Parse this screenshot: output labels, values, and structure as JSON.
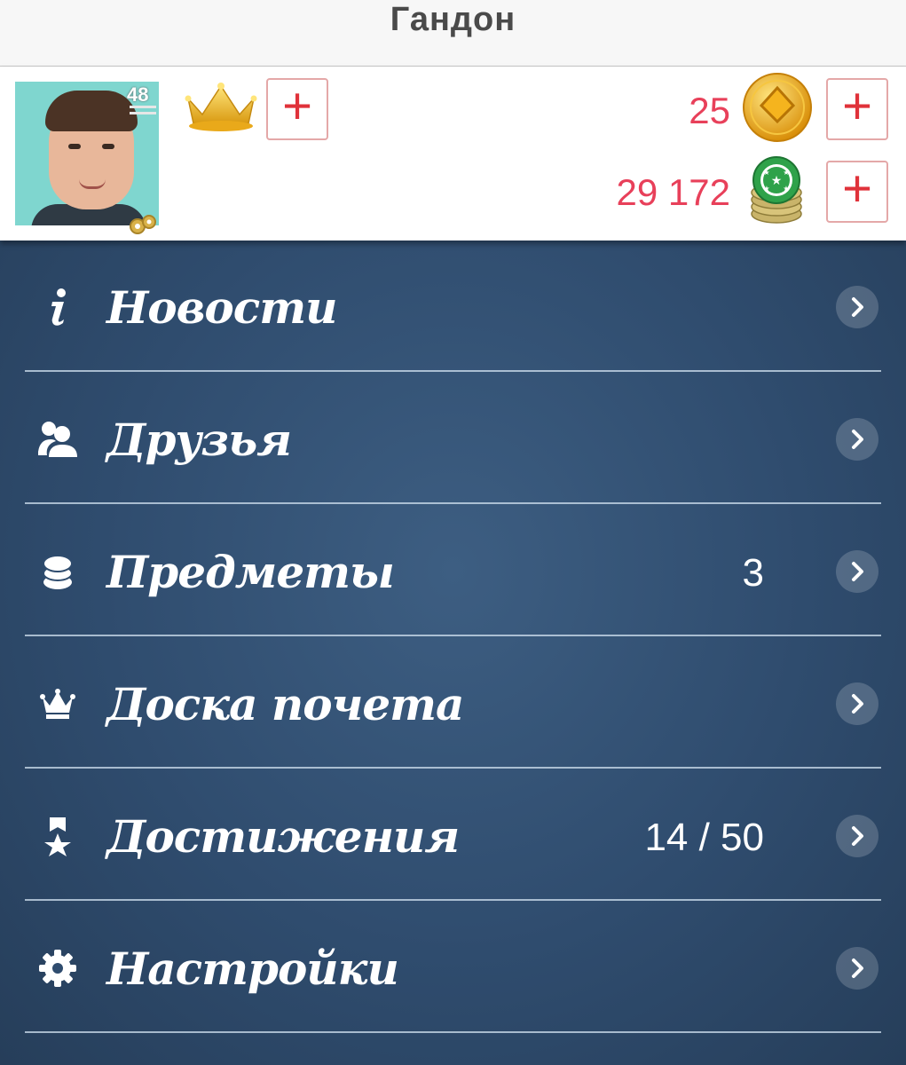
{
  "header": {
    "title": "Гандон"
  },
  "profile": {
    "level": "48",
    "gold": {
      "amount": "25",
      "icon": "gold-coin-icon",
      "color": "#e8405a"
    },
    "chips": {
      "amount": "29 172",
      "icon": "chip-stack-icon",
      "color": "#e8405a"
    },
    "crown_icon": "crown-icon",
    "plus_symbol": "+"
  },
  "menu": {
    "items": [
      {
        "label": "Новости",
        "icon": "info-icon",
        "count": ""
      },
      {
        "label": "Друзья",
        "icon": "friends-icon",
        "count": ""
      },
      {
        "label": "Предметы",
        "icon": "items-icon",
        "count": "3"
      },
      {
        "label": "Доска почета",
        "icon": "crown-icon",
        "count": ""
      },
      {
        "label": "Достижения",
        "icon": "achievement-icon",
        "count": "14 / 50"
      },
      {
        "label": "Настройки",
        "icon": "gear-icon",
        "count": ""
      }
    ]
  }
}
